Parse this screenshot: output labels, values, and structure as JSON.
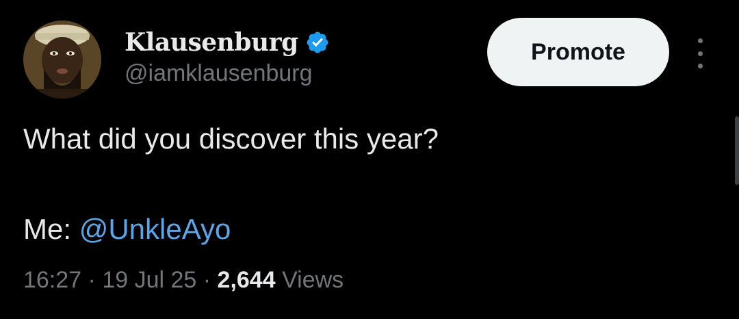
{
  "author": {
    "display_name": "Klausenburg",
    "handle": "@iamklausenburg",
    "verified": true,
    "avatar": "profile-photo"
  },
  "actions": {
    "promote_label": "Promote",
    "more_icon": "more-vertical-icon"
  },
  "tweet": {
    "line1": "What did you discover this year?",
    "line2_prefix": "Me: ",
    "mention": "@UnkleAyo"
  },
  "meta": {
    "time": "16:27",
    "separator": " · ",
    "date": "19 Jul 25",
    "views_count": "2,644",
    "views_label": " Views"
  },
  "colors": {
    "background": "#000000",
    "text_primary": "#e7e9ea",
    "text_secondary": "#71767b",
    "link": "#5aa6e8",
    "verified_badge": "#1d9bf0",
    "promote_button_bg": "#eff3f4"
  }
}
